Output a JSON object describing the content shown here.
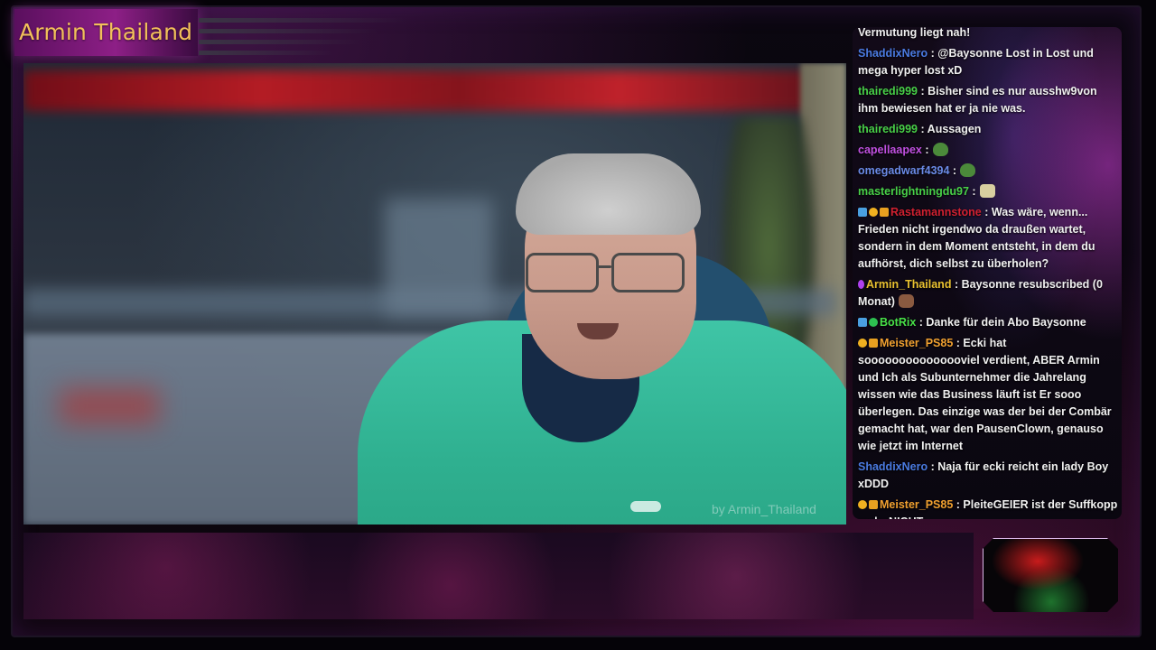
{
  "overlay": {
    "channel_title": "Armin Thailand",
    "watermark": "by Armin_Thailand"
  },
  "chat": {
    "messages": [
      {
        "user": "",
        "text": "Vermutung liegt nah!",
        "badges": []
      },
      {
        "user": "ShaddixNero",
        "user_color": "#4a7ae0",
        "text": ": @Baysonne Lost in Lost und mega hyper lost xD",
        "badges": []
      },
      {
        "user": "thairedi999",
        "user_color": "#48d048",
        "text": ": Bisher sind es nur ausshw9von ihm bewiesen hat er ja nie was.",
        "badges": []
      },
      {
        "user": "thairedi999",
        "user_color": "#48d048",
        "text": ": Aussagen",
        "badges": []
      },
      {
        "user": "capellaapex",
        "user_color": "#c050e0",
        "text": ":",
        "badges": [],
        "emote": "frog-emote"
      },
      {
        "user": "omegadwarf4394",
        "user_color": "#6a8ae6",
        "text": ":",
        "badges": [],
        "emote": "frog-emote"
      },
      {
        "user": "masterlightningdu97",
        "user_color": "#48d048",
        "text": ":",
        "badges": [],
        "emote": "cat-emote"
      },
      {
        "user": "Rastamannstone",
        "user_color": "#d02030",
        "text": ": Was wäre, wenn... Frieden nicht irgendwo da draußen wartet, sondern in dem Moment entsteht, in dem du aufhörst, dich selbst zu überholen?",
        "badges": [
          "prime",
          "bits",
          "sub"
        ]
      },
      {
        "user": "Armin_Thailand",
        "user_color": "#e8c030",
        "text": ": Baysonne resubscribed (0 Monat)",
        "badges": [
          "broadcaster"
        ],
        "emote": "face-emote"
      },
      {
        "user": "BotRix",
        "user_color": "#48e048",
        "text": ": Danke für dein Abo Baysonne",
        "badges": [
          "prime",
          "verified"
        ]
      },
      {
        "user": "Meister_PS85",
        "user_color": "#f0a030",
        "text": ": Ecki hat sooooooooooooooviel verdient, ABER Armin und Ich als Subunternehmer die Jahrelang wissen wie das Business läuft ist Er sooo überlegen. Das einzige was der bei der Combär gemacht hat, war den PausenClown, genauso wie jetzt im Internet",
        "badges": [
          "bits",
          "sub"
        ]
      },
      {
        "user": "ShaddixNero",
        "user_color": "#4a7ae0",
        "text": ": Naja für ecki reicht ein lady Boy xDDD",
        "badges": []
      },
      {
        "user": "Meister_PS85",
        "user_color": "#f0a030",
        "text": ": PleiteGEIER ist der Suffkopp mehr NICHT",
        "badges": [
          "bits",
          "sub"
        ]
      }
    ]
  }
}
